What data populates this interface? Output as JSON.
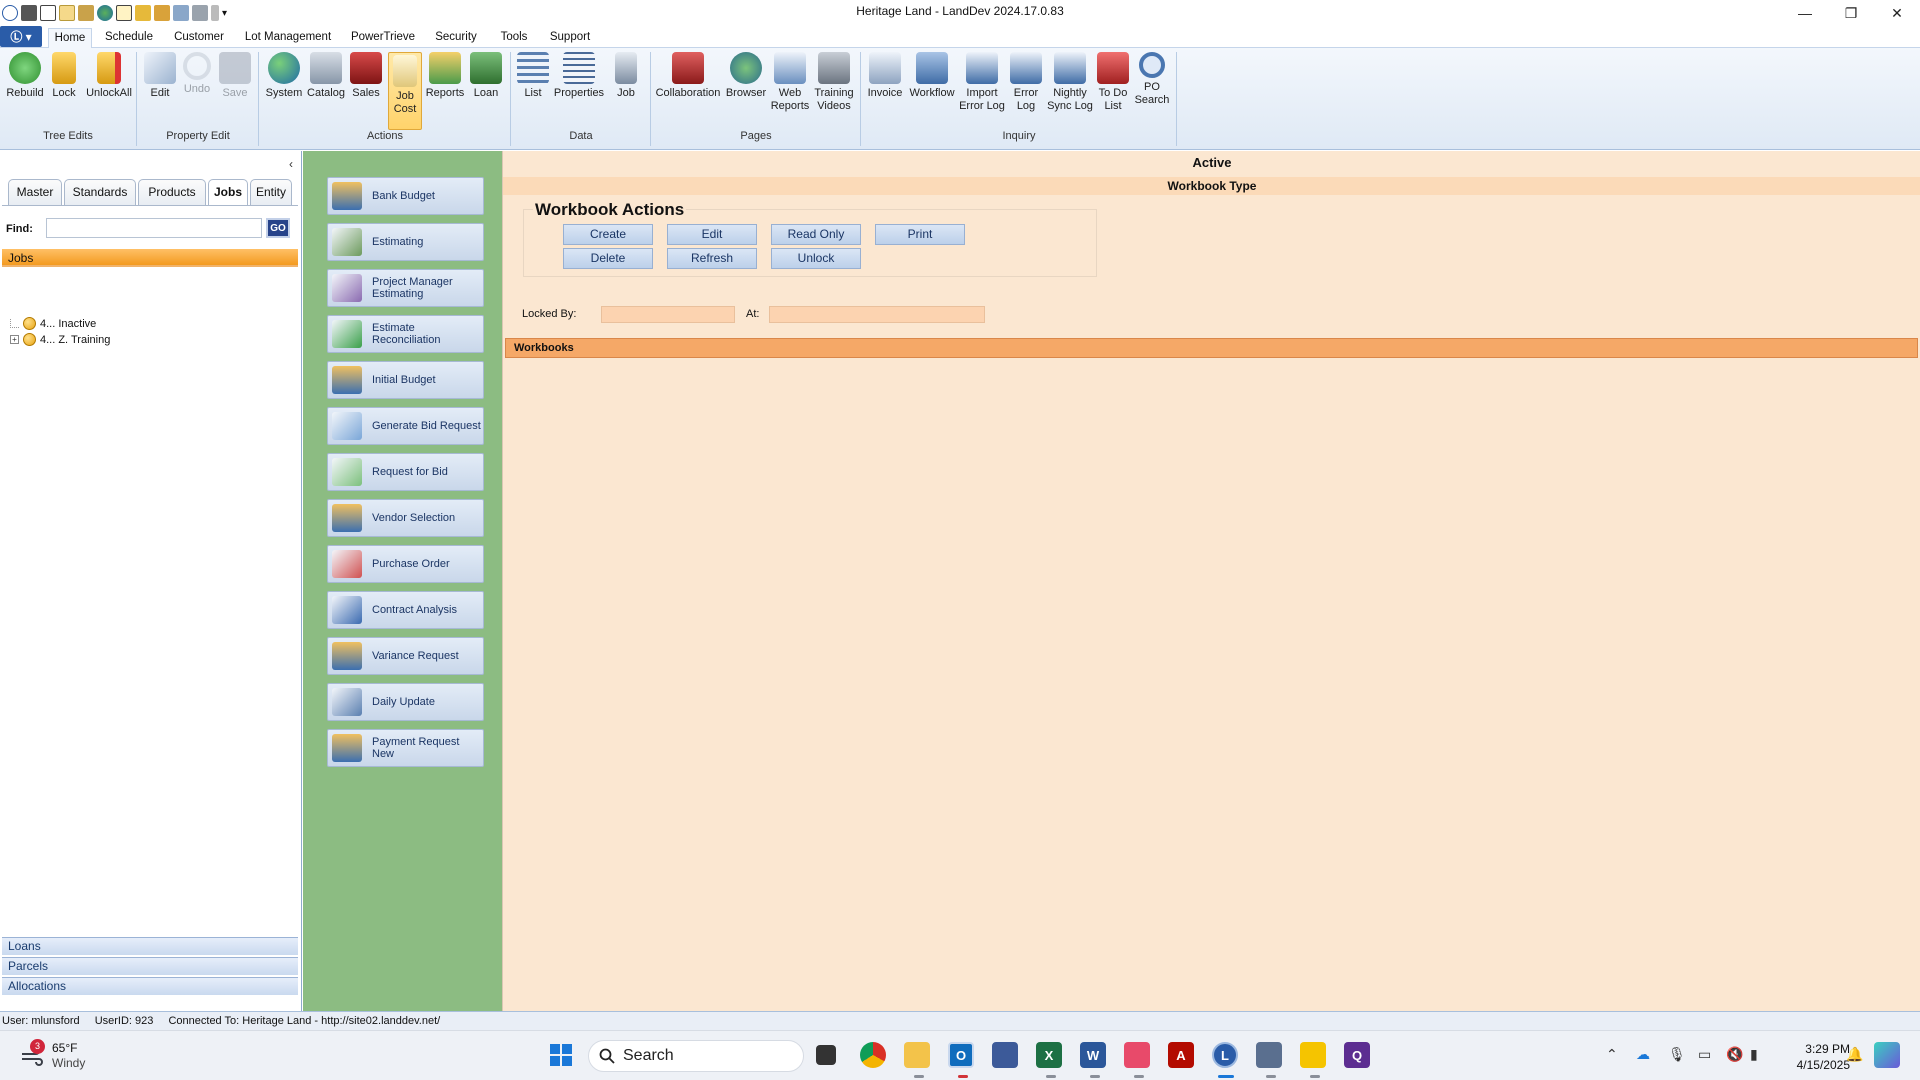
{
  "window": {
    "title": "Heritage Land - LandDev 2024.17.0.83",
    "minimize": "—",
    "maximize": "❐",
    "close": "✕"
  },
  "app_button": {
    "label": "Ⓛ ▾"
  },
  "ribbon_tabs": [
    "Home",
    "Schedule",
    "Customer",
    "Lot Management",
    "PowerTrieve",
    "Security",
    "Tools",
    "Support"
  ],
  "ribbon": {
    "groups": [
      "Tree Edits",
      "Property Edit",
      "Actions",
      "Data",
      "Pages",
      "Inquiry"
    ],
    "buttons": {
      "rebuild": "Rebuild",
      "lock": "Lock",
      "unlockall": "UnlockAll",
      "edit": "Edit",
      "undo": "Undo",
      "save": "Save",
      "system": "System",
      "catalog": "Catalog",
      "sales": "Sales",
      "job_cost_1": "Job",
      "job_cost_2": "Cost",
      "reports": "Reports",
      "loan": "Loan",
      "list": "List",
      "properties": "Properties",
      "job": "Job",
      "collaboration": "Collaboration",
      "browser": "Browser",
      "web_reports_1": "Web",
      "web_reports_2": "Reports",
      "training_1": "Training",
      "training_2": "Videos",
      "invoice": "Invoice",
      "workflow": "Workflow",
      "import_1": "Import",
      "import_2": "Error Log",
      "error_1": "Error",
      "error_2": "Log",
      "nightly_1": "Nightly",
      "nightly_2": "Sync Log",
      "todo_1": "To Do",
      "todo_2": "List",
      "po_1": "PO",
      "po_2": "Search"
    }
  },
  "left_panel": {
    "collapse": "‹",
    "tabs": [
      "Master",
      "Standards",
      "Products",
      "Jobs",
      "Entity"
    ],
    "find_label": "Find:",
    "find_value": "",
    "go_label": "GO",
    "section": "Jobs",
    "tree": [
      {
        "label": "4... Inactive",
        "expandable": false
      },
      {
        "label": "4... Z. Training",
        "expandable": true,
        "expander": "+"
      }
    ],
    "nav": [
      "Loans",
      "Parcels",
      "Allocations"
    ]
  },
  "modules": [
    "Bank Budget",
    "Estimating",
    "Project Manager Estimating",
    "Estimate Reconciliation",
    "Initial Budget",
    "Generate Bid Request",
    "Request for Bid",
    "Vendor Selection",
    "Purchase Order",
    "Contract Analysis",
    "Variance Request",
    "Daily Update",
    "Payment Request New"
  ],
  "main": {
    "status": "Active",
    "workbook_type": "Workbook Type",
    "actions_title": "Workbook Actions",
    "actions": {
      "create": "Create",
      "edit": "Edit",
      "read_only": "Read Only",
      "print": "Print",
      "delete": "Delete",
      "refresh": "Refresh",
      "unlock": "Unlock"
    },
    "locked_by_label": "Locked By:",
    "locked_by_value": "",
    "at_label": "At:",
    "at_value": "",
    "workbooks_label": "Workbooks"
  },
  "status_bar": {
    "user": "User: mlunsford",
    "user_id": "UserID: 923",
    "connected": "Connected To: Heritage Land  -  http://site02.landdev.net/"
  },
  "taskbar": {
    "weather_badge": "3",
    "temperature": "65°F",
    "condition": "Windy",
    "search_placeholder": "Search",
    "time": "3:29 PM",
    "date": "4/15/2025"
  },
  "colors": {
    "ribbon_accent": "#2a5ca8",
    "module_panel": "#8cbc82",
    "main_bg": "#fbe7d1",
    "workbooks_bar": "#f5a867",
    "jobs_bar": "#f39a20"
  }
}
